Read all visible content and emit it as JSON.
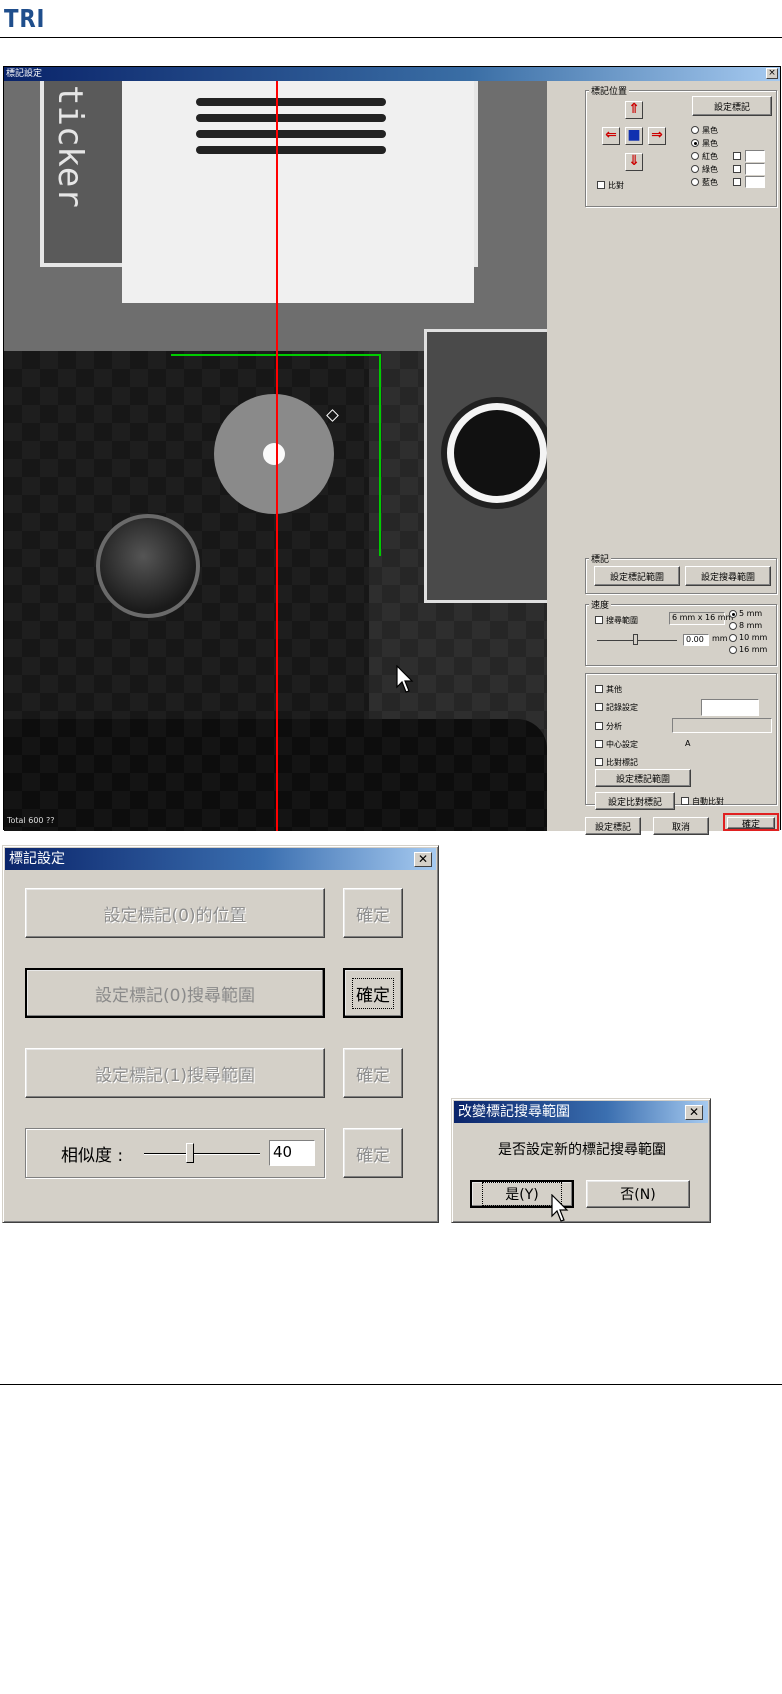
{
  "page": {
    "logo": "TRI"
  },
  "main_window": {
    "title": "標記設定",
    "close_glyph": "×",
    "status_text": "Total 600 ??",
    "panel_top": {
      "group_label": "標記位置",
      "button": "設定標記",
      "radios": [
        "黑色",
        "黑色",
        "紅色",
        "綠色",
        "藍色"
      ],
      "checkbox_label": "比對"
    },
    "panel_mid": {
      "group_label": "標記",
      "buttons": [
        "設定標記範圍",
        "設定搜尋範圍"
      ]
    },
    "panel_speed": {
      "group_label": "速度",
      "checkbox_label": "搜尋範圍",
      "combo": "6 mm x 16 mm",
      "field_value": "0.00",
      "unit": "mm",
      "radios": [
        "5 mm",
        "8 mm",
        "10 mm",
        "16 mm"
      ]
    },
    "panel_opts": {
      "checkboxes": [
        "其他",
        "記錄設定",
        "分析",
        "中心設定",
        "比對標記"
      ],
      "value_a": "A",
      "button_1": "設定標記範圍",
      "button_2": "設定比對標記",
      "checkbox_right": "自動比對"
    },
    "footer_buttons": [
      "設定標記",
      "取消",
      "確定"
    ]
  },
  "mark_dialog": {
    "title": "標記設定",
    "close_glyph": "✕",
    "rows": [
      {
        "label": "設定標記(0)的位置",
        "ok": "確定"
      },
      {
        "label": "設定標記(0)搜尋範圍",
        "ok": "確定"
      },
      {
        "label": "設定標記(1)搜尋範圍",
        "ok": "確定"
      }
    ],
    "similarity_label": "相似度 :",
    "similarity_value": "40",
    "similarity_level": 0.4,
    "similarity_ok": "確定"
  },
  "confirm_dialog": {
    "title": "改變標記搜尋範圍",
    "close_glyph": "✕",
    "message": "是否設定新的標記搜尋範圍",
    "yes": "是(Y)",
    "no": "否(N)"
  },
  "colors": {
    "title_bar": "#0a246a",
    "crosshair": "#ff0000",
    "roi": "#00cc00",
    "highlight": "#e02020",
    "logo": "#1f4e8c"
  }
}
